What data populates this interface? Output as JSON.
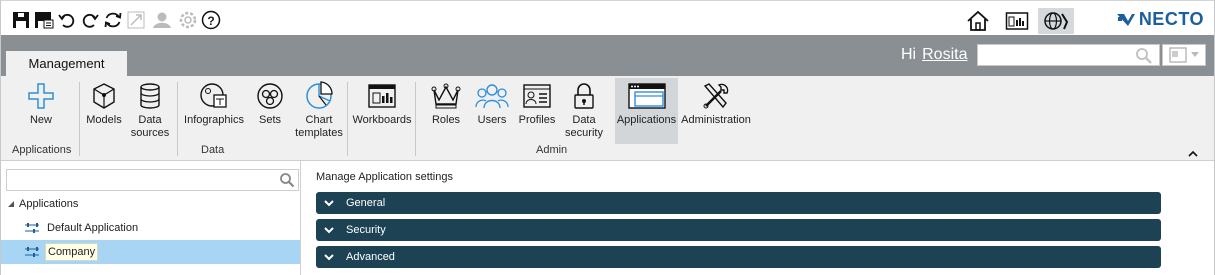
{
  "toolbar": {
    "left_icons": [
      "save-icon",
      "save-as-icon",
      "undo-icon",
      "redo-icon",
      "refresh-icon",
      "fullscreen-icon",
      "share-icon",
      "settings-icon",
      "help-icon"
    ],
    "help_label": "?",
    "right_icons": [
      "home-icon",
      "dashboard-icon",
      "globe-admin-icon"
    ],
    "logo_text": "NECTO"
  },
  "header": {
    "tab_label": "Management",
    "greeting": "Hi",
    "user": "Rosita",
    "search_placeholder": ""
  },
  "ribbon": {
    "groups": [
      {
        "label": "Applications",
        "items": [
          {
            "label": "New",
            "icon": "plus-icon"
          }
        ]
      },
      {
        "label": "Data",
        "items": [
          {
            "label": "Models",
            "icon": "cube-icon"
          },
          {
            "label": "Data sources",
            "icon": "database-icon"
          },
          {
            "label": "Infographics",
            "icon": "infographics-icon"
          },
          {
            "label": "Sets",
            "icon": "sets-icon"
          },
          {
            "label": "Chart templates",
            "icon": "pie-chart-icon"
          }
        ]
      },
      {
        "label": "Admin",
        "items": [
          {
            "label": "Workboards",
            "icon": "workboard-icon"
          },
          {
            "label": "Roles",
            "icon": "crown-icon"
          },
          {
            "label": "Users",
            "icon": "users-icon"
          },
          {
            "label": "Profiles",
            "icon": "profile-icon"
          },
          {
            "label": "Data security",
            "icon": "lock-icon"
          },
          {
            "label": "Applications",
            "icon": "window-icon"
          },
          {
            "label": "Administration",
            "icon": "tools-icon"
          }
        ]
      }
    ],
    "labels": {
      "new": "New",
      "models": "Models",
      "data_sources_1": "Data",
      "data_sources_2": "sources",
      "infographics": "Infographics",
      "sets": "Sets",
      "chart_templates_1": "Chart",
      "chart_templates_2": "templates",
      "workboards": "Workboards",
      "roles": "Roles",
      "users": "Users",
      "profiles": "Profiles",
      "data_security_1": "Data",
      "data_security_2": "security",
      "applications": "Applications",
      "administration": "Administration",
      "group_applications": "Applications",
      "group_data": "Data",
      "group_admin": "Admin"
    },
    "selected": "Applications"
  },
  "left_panel": {
    "search_value": "",
    "root_label": "Applications",
    "items": [
      {
        "label": "Default Application",
        "selected": false
      },
      {
        "label": "Company",
        "selected": true
      }
    ]
  },
  "main": {
    "title": "Manage Application settings",
    "sections": [
      "General",
      "Security",
      "Advanced"
    ]
  },
  "colors": {
    "accent_blue": "#1b5f9c",
    "header_gray": "#8a8f93",
    "ribbon_bg": "#f0f0f0",
    "accordion_bg": "#1c4254",
    "selection_blue": "#a9d5f5"
  }
}
